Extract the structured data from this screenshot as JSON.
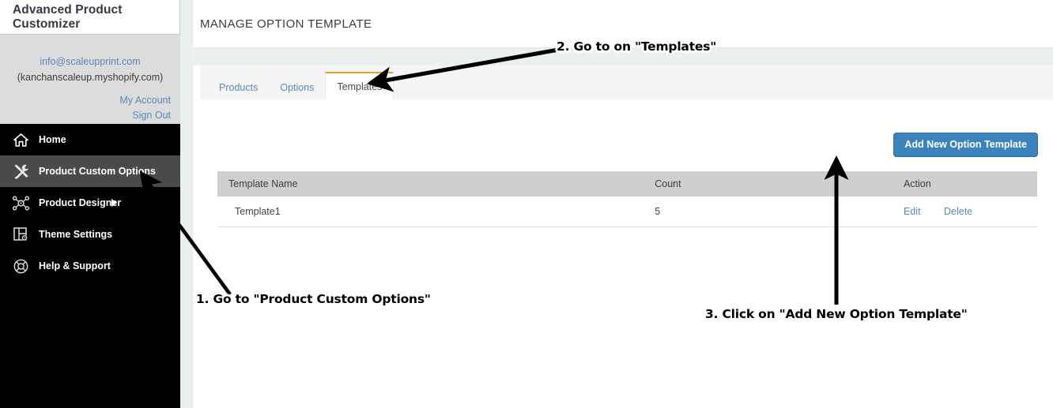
{
  "sidebar": {
    "brand_title": "Advanced Product Customizer",
    "account": {
      "email": "info@scaleupprint.com",
      "shop": "(kanchanscaleup.myshopify.com)",
      "my_account_label": "My Account",
      "sign_out_label": "Sign Out"
    },
    "nav_items": [
      {
        "label": "Home",
        "icon": "home-icon",
        "active": false,
        "has_caret": false
      },
      {
        "label": "Product Custom Options",
        "icon": "tools-icon",
        "active": true,
        "has_caret": false
      },
      {
        "label": "Product Designer",
        "icon": "designer-node-icon",
        "active": false,
        "has_caret": true
      },
      {
        "label": "Theme Settings",
        "icon": "theme-panel-gear-icon",
        "active": false,
        "has_caret": false
      },
      {
        "label": "Help & Support",
        "icon": "lifering-icon",
        "active": false,
        "has_caret": false
      }
    ]
  },
  "main": {
    "page_title": "MANAGE OPTION TEMPLATE",
    "tabs": [
      {
        "label": "Products",
        "active": false
      },
      {
        "label": "Options",
        "active": false
      },
      {
        "label": "Templates",
        "active": true
      }
    ],
    "add_button_label": "Add New Option Template",
    "table": {
      "columns": [
        "Template Name",
        "Count",
        "Action"
      ],
      "rows": [
        {
          "name": "Template1",
          "count": "5",
          "edit_label": "Edit",
          "delete_label": "Delete"
        }
      ]
    }
  },
  "annotations": [
    {
      "id": "anno1",
      "text": "1. Go to \"Product Custom Options\""
    },
    {
      "id": "anno2",
      "text": "2. Go to on \"Templates\""
    },
    {
      "id": "anno3",
      "text": "3. Click on \"Add New Option Template\""
    }
  ],
  "colors": {
    "sidebar_nav_bg": "#000000",
    "sidebar_active_bg": "#4a4a4a",
    "sidebar_upper_bg": "#dcdcdc",
    "link_blue": "#5b87b5",
    "primary_button": "#3c82bd",
    "active_tab_accent": "#f0a020",
    "table_header_bg": "#cfcfcf",
    "page_gap": "#eceff0"
  }
}
